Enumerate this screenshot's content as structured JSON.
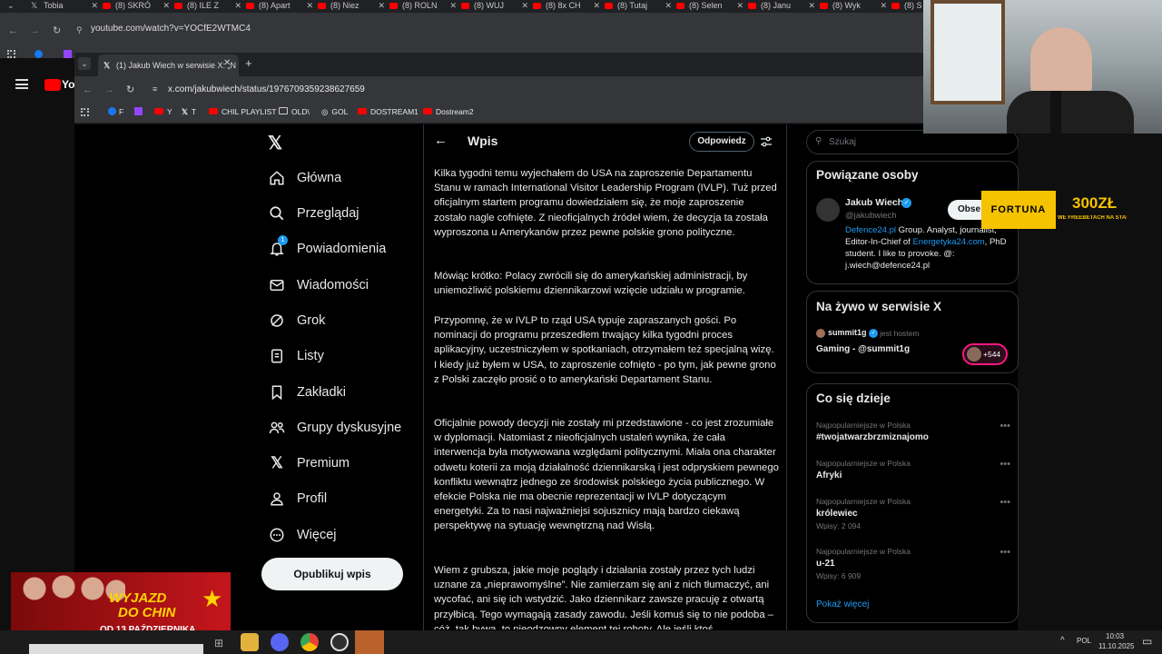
{
  "outer": {
    "tabs": [
      "Tobia",
      "(8) SKRÓ",
      "(8) ILE Z",
      "(8) Apart",
      "(8) Niez",
      "(8) ROLN",
      "(8) WUJ",
      "(8) 8x CH",
      "(8) Tutaj",
      "(8) Selen",
      "(8) Janu",
      "(8) Wyk",
      "(8) S"
    ],
    "url": "youtube.com/watch?v=YOCfE2WTMC4",
    "yt_logo": "Yo"
  },
  "inner": {
    "tab_title": "(1) Jakub Wiech w serwisie X: „N",
    "url": "x.com/jakubwiech/status/1976709359238627659",
    "bookmarks": [
      "F",
      "Y",
      "T",
      "CHIL PLAYLIST",
      "OLD\\",
      "GOL",
      "DOSTREAM1",
      "Dostream2"
    ]
  },
  "nav": {
    "items": [
      {
        "label": "Główna",
        "icon": "home-icon"
      },
      {
        "label": "Przeglądaj",
        "icon": "search-icon"
      },
      {
        "label": "Powiadomienia",
        "icon": "bell-icon"
      },
      {
        "label": "Wiadomości",
        "icon": "envelope-icon"
      },
      {
        "label": "Grok",
        "icon": "grok-icon"
      },
      {
        "label": "Listy",
        "icon": "list-icon"
      },
      {
        "label": "Zakładki",
        "icon": "bookmark-icon"
      },
      {
        "label": "Grupy dyskusyjne",
        "icon": "people-icon"
      },
      {
        "label": "Premium",
        "icon": "x-logo-icon"
      },
      {
        "label": "Profil",
        "icon": "person-icon"
      },
      {
        "label": "Więcej",
        "icon": "more-icon"
      }
    ],
    "post_button": "Opublikuj wpis",
    "badge": "1"
  },
  "post": {
    "header": "Wpis",
    "reply": "Odpowiedz",
    "paragraphs": [
      "Kilka tygodni temu wyjechałem do USA na zaproszenie Departamentu Stanu w ramach International Visitor Leadership Program (IVLP). Tuż przed oficjalnym startem programu dowiedziałem się, że moje zaproszenie zostało nagle cofnięte. Z nieoficjalnych źródeł wiem, że decyzja ta została wyproszona u Amerykanów przez pewne polskie grono polityczne.",
      "Mówiąc krótko: Polacy zwrócili się do amerykańskiej administracji, by uniemożliwić polskiemu dziennikarzowi wzięcie udziału w programie.",
      "Przypomnę, że w IVLP to rząd USA typuje zapraszanych gości. Po nominacji do programu przeszedłem trwający kilka tygodni proces aplikacyjny, uczestniczyłem w spotkaniach, otrzymałem też specjalną wizę. I kiedy już byłem w USA, to zaproszenie cofnięto - po tym, jak pewne grono z Polski zaczęło prosić o to amerykański Departament Stanu.",
      "Oficjalnie powody decyzji nie zostały mi przedstawione - co jest zrozumiałe w dyplomacji. Natomiast z nieoficjalnych ustaleń wynika, że cała interwencja była motywowana względami politycznymi. Miała ona charakter odwetu koterii za moją działalność dziennikarską i jest odpryskiem pewnego konfliktu wewnątrz jednego ze środowisk polskiego życia publicznego. W efekcie Polska nie ma obecnie reprezentacji w IVLP dotyczącym energetyki. Za to nasi najważniejsi sojusznicy mają bardzo ciekawą perspektywę na sytuację wewnętrzną nad Wisłą.",
      "Wiem z grubsza, jakie moje poglądy i działania zostały przez tych ludzi uznane za „nieprawomyślne”. Nie zamierzam się ani z nich tłumaczyć, ani wycofać, ani się ich wstydzić. Jako dziennikarz zawsze pracuję z otwartą przyłbicą. Tego wymagają zasady zawodu. Jeśli komuś się to nie podoba – cóż, tak bywa, to nieodzowny element tej roboty. Ale jeśli ktoś"
    ]
  },
  "sidebar": {
    "search_placeholder": "Szukaj",
    "related_title": "Powiązane osoby",
    "person_name": "Jakub Wiech",
    "person_handle": "@jakubwiech",
    "follow": "Obse",
    "bio_link1": "Defence24.pl",
    "bio1": " Group. Analyst, journalist, Editor-In-Chief of ",
    "bio_link2": "Energetyka24.com",
    "bio2": ", PhD student. I like to provoke. @: j.wiech@defence24.pl",
    "live_title": "Na żywo w serwisie X",
    "live_host": "summit1g",
    "live_host_suffix": "jest hostem",
    "live_name": "Gaming - @summit1g",
    "live_count": "+544",
    "trends_title": "Co się dzieje",
    "trends": [
      {
        "ctx": "Najpopularniejsze w Polska",
        "name": "#twojatwarzbrzmiznajomo",
        "count": ""
      },
      {
        "ctx": "Najpopularniejsze w Polska",
        "name": "Afryki",
        "count": ""
      },
      {
        "ctx": "Najpopularniejsze w Polska",
        "name": "królewiec",
        "count": "Wpisy: 2 094"
      },
      {
        "ctx": "Najpopularniejsze w Polska",
        "name": "u-21",
        "count": "Wpisy: 6 909"
      }
    ],
    "show_more": "Pokaż więcej"
  },
  "overlay": {
    "fortuna": "FORTUNA",
    "bonus": "300ZŁ",
    "bonus_sub": "WE FREEBETACH NA START",
    "banner_line1": "WYJAZD",
    "banner_line2": "DO CHIN",
    "banner_date": "OD 13 PAŹDZIERNIKA"
  },
  "taskbar": {
    "lang": "POL",
    "time": "10:03",
    "date": "11.10.2025"
  },
  "colors": {
    "accent": "#1d9bf0",
    "x_black": "#000000",
    "chrome": "#35363a",
    "yt_red": "#ff0000",
    "fortuna_yellow": "#f6c300"
  }
}
